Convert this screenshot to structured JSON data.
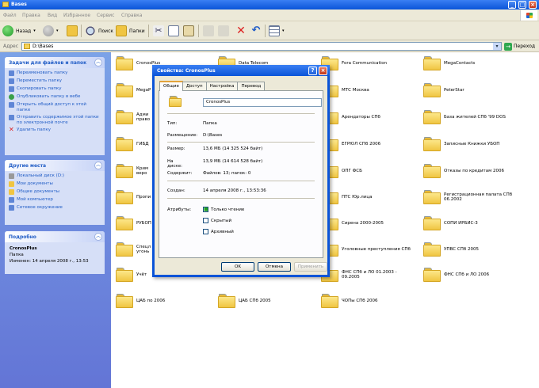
{
  "window": {
    "title": "Bases"
  },
  "menu": [
    "Файл",
    "Правка",
    "Вид",
    "Избранное",
    "Сервис",
    "Справка"
  ],
  "toolbar": {
    "back": "Назад",
    "search": "Поиск",
    "folders": "Папки"
  },
  "address": {
    "label": "Адрес",
    "value": "D:\\Bases",
    "go": "Переход"
  },
  "tasks": {
    "title": "Задачи для файлов и папок",
    "items": [
      "Переименовать папку",
      "Переместить папку",
      "Скопировать папку",
      "Опубликовать папку в вебе",
      "Открыть общий доступ к этой папке",
      "Отправить содержимое этой папки по электронной почте",
      "Удалить папку"
    ]
  },
  "places": {
    "title": "Другие места",
    "items": [
      "Локальный диск (D:)",
      "Мои документы",
      "Общие документы",
      "Мой компьютер",
      "Сетевое окружение"
    ]
  },
  "details": {
    "title": "Подробно",
    "name": "CronosPlus",
    "type": "Папка",
    "modified": "Изменен: 14 апреля 2008 г., 13:53"
  },
  "folders": {
    "col1": [
      "CronosPlus",
      "MegaP",
      "Адми\nправо",
      "ГИБД",
      "Крим\nверо",
      "Пропи",
      "РУБОП",
      "Спецл\nугонь",
      "Учёт",
      "ЦАБ по 2006"
    ],
    "col2": [
      "Data Telecom",
      "ЦАБ СПб 2005"
    ],
    "col3": [
      "Fora Communication",
      "МТС Москва",
      "Арендаторы СПб",
      "ЕГРЮЛ СПб 2006",
      "ОПГ ФСБ",
      "ПТС Юр.лица",
      "Сирена 2000-2005",
      "Уголовные преступления СПб",
      "ФНС СПб и ЛО 01.2003 -\n09.2005",
      "ЧОПы СПб 2006"
    ],
    "col4": [
      "MegaContacts",
      "PeterStar",
      "База жителей СПб '99 DOS",
      "Записные Книжки УБОП",
      "Отказы по кредитам 2006",
      "Регистрационная палата СПб\n06.2002",
      "СОПИ ИРБИС-3",
      "УПВС СПб 2005",
      "ФНС СПб и ЛО 2006"
    ]
  },
  "dialog": {
    "title": "Свойства: CronosPlus",
    "tabs": [
      "Общие",
      "Доступ",
      "Настройка",
      "Перевод"
    ],
    "name": "CronosPlus",
    "fields": {
      "type_k": "Тип:",
      "type_v": "Папка",
      "loc_k": "Размещение:",
      "loc_v": "D:\\Bases",
      "size_k": "Размер:",
      "size_v": "13,6 МБ (14 325 524 байт)",
      "disk_k": "На диске:",
      "disk_v": "13,9 МБ (14 614 528 байт)",
      "cont_k": "Содержит:",
      "cont_v": "Файлов: 13; папок: 0",
      "created_k": "Создан:",
      "created_v": "14 апреля 2008 г., 13:53:36",
      "attr_k": "Атрибуты:"
    },
    "attrs": [
      "Только чтение",
      "Скрытый",
      "Архивный"
    ],
    "buttons": {
      "ok": "OK",
      "cancel": "Отмена",
      "apply": "Применить"
    }
  }
}
